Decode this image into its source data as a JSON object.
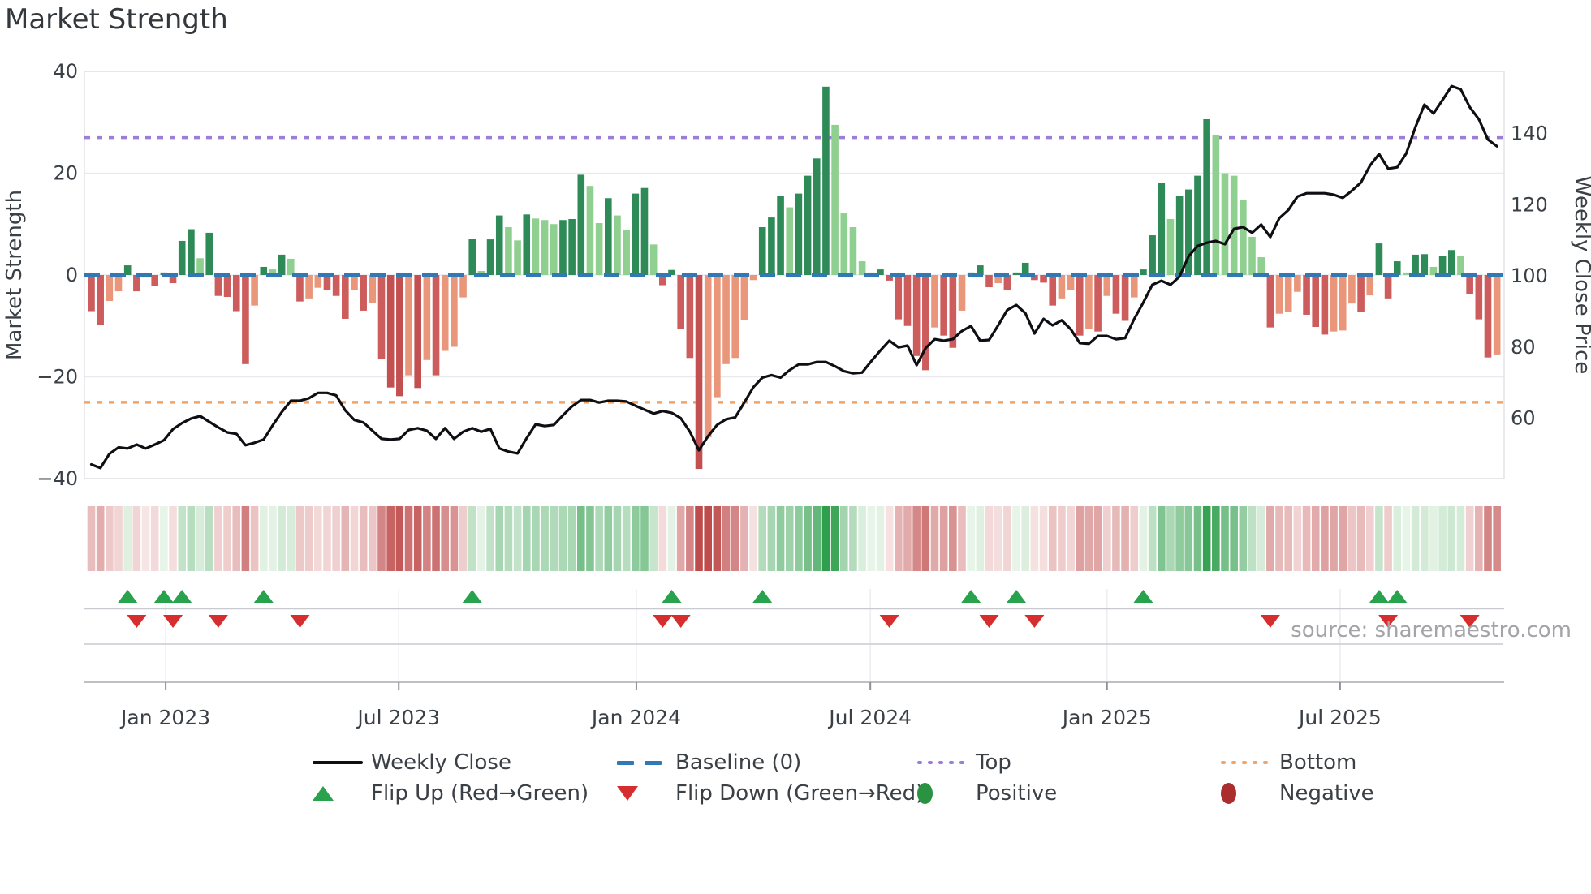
{
  "title": "Market Strength",
  "source": {
    "text": "source: sharemaestro.com"
  },
  "legend": {
    "items": [
      {
        "label": "Weekly Close"
      },
      {
        "label": "Baseline (0)"
      },
      {
        "label": "Top"
      },
      {
        "label": "Bottom"
      },
      {
        "label": "Flip Up (Red→Green)"
      },
      {
        "label": "Flip Down (Green→Red)"
      },
      {
        "label": "Positive"
      },
      {
        "label": "Negative"
      }
    ]
  },
  "colors": {
    "bar_positive_strong": "#2e8b57",
    "bar_positive_weak": "#8fcf90",
    "bar_negative_strong": "#cd5c5c",
    "bar_negative_deep": "#c25050",
    "bar_negative_weak": "#e9967a",
    "price_line": "#0e0e13",
    "baseline": "#3178b5",
    "top_line": "#9d7ed6",
    "bottom_line": "#f3a465",
    "flip_up": "#28a24c",
    "flip_down": "#d62e2e",
    "grid": "#e9e9ef",
    "text": "#3a4046"
  },
  "chart_data": {
    "type": "composite",
    "subtype": "weekly bar oscillator + price line + heat strip + flip markers",
    "title": "Market Strength",
    "left_axis": {
      "label": "Market Strength",
      "ticks": [
        "40",
        "20",
        "0",
        "−20",
        "−40"
      ],
      "tick_values": [
        40,
        20,
        0,
        -20,
        -40
      ],
      "range": [
        -40,
        40
      ]
    },
    "right_axis": {
      "label": "Weekly Close Price",
      "ticks": [
        "140",
        "120",
        "100",
        "80",
        "60"
      ],
      "tick_values": [
        140,
        120,
        100,
        80,
        60
      ],
      "range": [
        43,
        157
      ]
    },
    "x_axis": {
      "tick_labels": [
        "Jan 2023",
        "Jul 2023",
        "Jan 2024",
        "Jul 2024",
        "Jan 2025",
        "Jul 2025"
      ],
      "tick_weeks": [
        8.2,
        33.9,
        60.1,
        85.9,
        112.0,
        137.7
      ],
      "n_weeks": 156,
      "unit": "week"
    },
    "thresholds": {
      "baseline": {
        "label": "Baseline (0)",
        "value": 0
      },
      "top": {
        "label": "Top",
        "value": 27
      },
      "bottom": {
        "label": "Bottom",
        "value": -25
      }
    },
    "series": [
      {
        "name": "Market Strength",
        "type": "bar",
        "values": [
          -7.1,
          -9.8,
          -5.1,
          -3.2,
          1.9,
          -3.2,
          -0.5,
          -2.1,
          0.5,
          -1.6,
          6.7,
          9,
          3.3,
          8.3,
          -4.1,
          -4.3,
          -7.1,
          -17.5,
          -6,
          1.6,
          1.1,
          4,
          3.2,
          -5.2,
          -4.6,
          -2.5,
          -3,
          -4.1,
          -8.6,
          -2.9,
          -7,
          -5.5,
          -16.5,
          -22.1,
          -23.8,
          -19.7,
          -22.2,
          -16.7,
          -19.7,
          -14.9,
          -14.1,
          -4.4,
          7.1,
          0.8,
          7,
          11.7,
          9.4,
          6.8,
          11.9,
          11.1,
          10.8,
          10,
          10.8,
          11,
          19.7,
          17.5,
          10.2,
          15.1,
          11.7,
          8.9,
          16,
          17.1,
          6,
          -2,
          1,
          -10.6,
          -16.3,
          -38.1,
          -31.9,
          -24,
          -17.5,
          -16.3,
          -8.9,
          -1,
          9.4,
          11.3,
          15.6,
          13.3,
          16,
          19.5,
          22.9,
          37,
          29.5,
          12.1,
          9.4,
          2.7,
          0.5,
          1.1,
          -1.1,
          -8.7,
          -10,
          -15.9,
          -18.7,
          -10.3,
          -11.9,
          -14.3,
          -7,
          0.5,
          1.9,
          -2.4,
          -1.6,
          -3,
          0.5,
          2.4,
          -1,
          -1.5,
          -6,
          -4.6,
          -2.9,
          -11.9,
          -10.6,
          -11.1,
          -4.1,
          -7.6,
          -9,
          -4.4,
          1.1,
          7.8,
          18.1,
          11,
          15.6,
          16.8,
          19.5,
          30.6,
          27.5,
          20,
          19.5,
          14.8,
          7.5,
          3.5,
          -10.3,
          -7.6,
          -7.3,
          -3.3,
          -7.8,
          -10.2,
          -11.7,
          -11.1,
          -10.9,
          -5.6,
          -7.3,
          -4,
          6.2,
          -4.6,
          2.7,
          0.5,
          4,
          4.1,
          1.6,
          3.8,
          4.9,
          3.8,
          -3.8,
          -8.7,
          -16.2,
          -15.6
        ]
      },
      {
        "name": "Weekly Close",
        "type": "line",
        "values": [
          47.0,
          46.0,
          50.0,
          51.8,
          51.5,
          52.6,
          51.5,
          52.6,
          53.8,
          56.9,
          58.6,
          59.9,
          60.6,
          59.0,
          57.4,
          56.0,
          55.6,
          52.4,
          53.1,
          54.0,
          58.0,
          61.7,
          64.9,
          64.9,
          65.6,
          67.1,
          67.1,
          66.4,
          62.2,
          59.5,
          58.8,
          56.5,
          54.2,
          54.0,
          54.2,
          56.7,
          57.2,
          56.5,
          54.2,
          57.2,
          54.2,
          56.2,
          57.2,
          56.2,
          57.0,
          51.5,
          50.6,
          50.1,
          54.4,
          58.3,
          57.8,
          58.1,
          60.8,
          63.3,
          65.1,
          65.1,
          64.4,
          64.9,
          64.9,
          64.7,
          63.5,
          62.4,
          61.3,
          62.0,
          61.5,
          60.0,
          56.2,
          51.0,
          54.9,
          58.1,
          59.7,
          60.2,
          64.4,
          68.7,
          71.4,
          72.1,
          71.4,
          73.5,
          75.1,
          75.1,
          75.8,
          75.8,
          74.6,
          73.2,
          72.6,
          72.8,
          76.0,
          79.0,
          81.8,
          79.9,
          80.4,
          74.9,
          79.7,
          82.2,
          81.8,
          82.2,
          84.5,
          85.9,
          81.8,
          82.0,
          86.1,
          90.4,
          91.8,
          89.5,
          83.8,
          87.9,
          86.1,
          87.5,
          85.0,
          81.1,
          80.9,
          83.1,
          83.1,
          82.2,
          82.5,
          87.9,
          92.5,
          97.5,
          98.6,
          97.5,
          99.8,
          105.5,
          108.4,
          109.3,
          109.8,
          108.9,
          113.2,
          113.7,
          112.1,
          114.4,
          110.9,
          116.2,
          118.5,
          122.3,
          123.2,
          123.2,
          123.2,
          122.8,
          121.9,
          123.9,
          126.2,
          131.0,
          134.2,
          130.1,
          130.5,
          134.4,
          141.7,
          148.1,
          145.6,
          149.4,
          153.3,
          152.4,
          147.4,
          144.0,
          138.3,
          136.4
        ]
      }
    ],
    "flips": {
      "up_weeks": [
        4,
        8,
        10,
        19,
        42,
        64,
        74,
        97,
        102,
        116,
        142,
        144
      ],
      "down_weeks": [
        5,
        9,
        14,
        23,
        63,
        65,
        88,
        99,
        104,
        130,
        143,
        152
      ]
    },
    "heat_strip": {
      "description": "red-to-green heat cells, one per week, colored by Market Strength value"
    },
    "legend_position": "bottom center, 2 rows",
    "grid": "horizontal gridlines at left-axis ticks; vertical gridlines only in lower marker/axis rows"
  }
}
